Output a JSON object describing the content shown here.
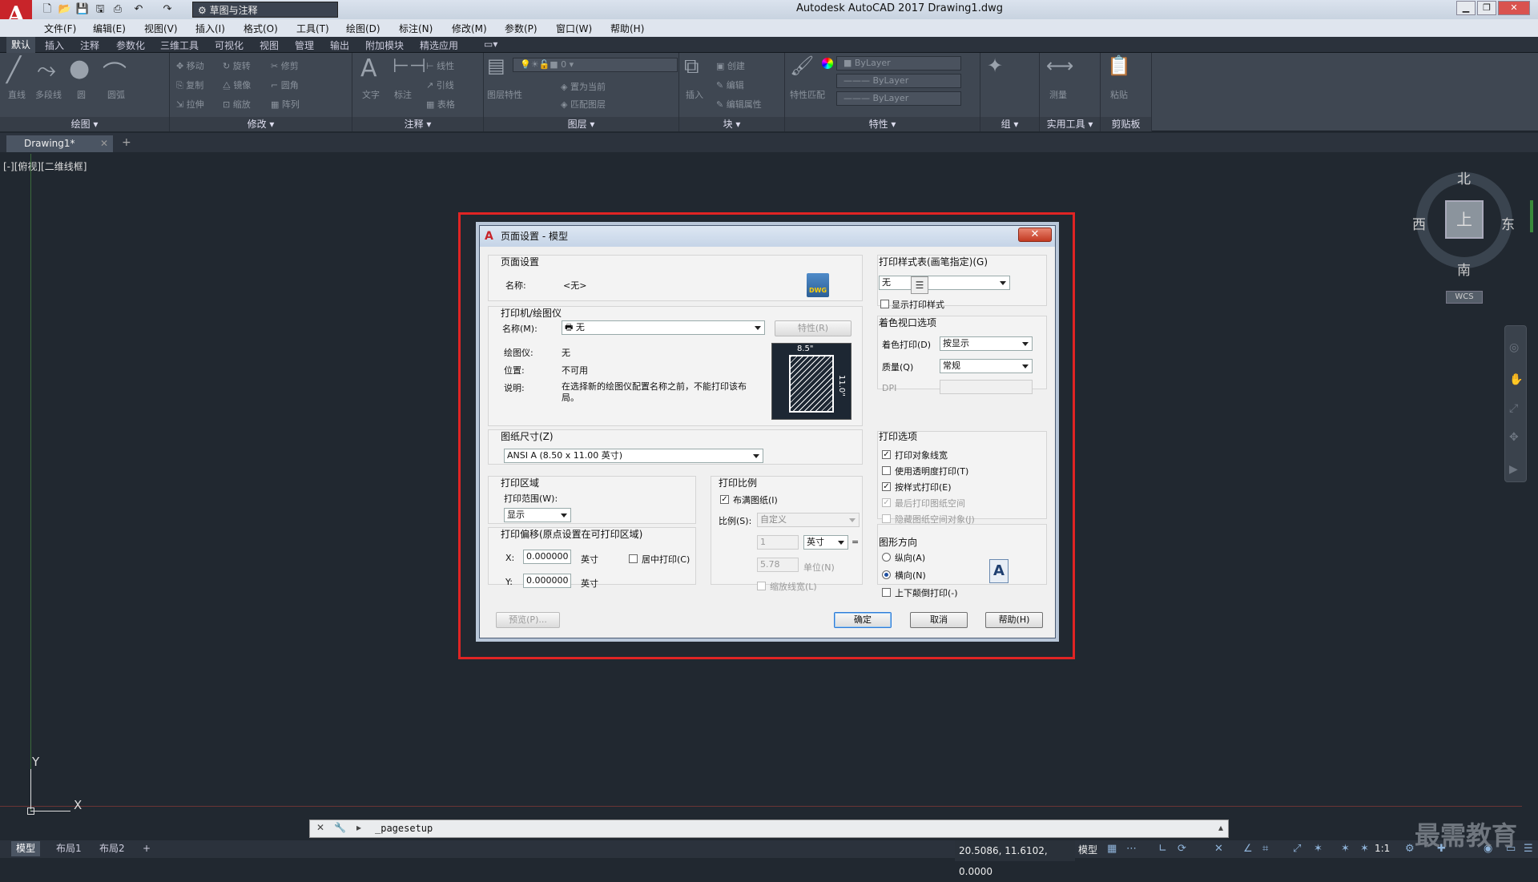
{
  "app": {
    "logo": "A",
    "window_title": "Autodesk AutoCAD 2017    Drawing1.dwg",
    "workspace": "草图与注释"
  },
  "menu": [
    "文件(F)",
    "编辑(E)",
    "视图(V)",
    "插入(I)",
    "格式(O)",
    "工具(T)",
    "绘图(D)",
    "标注(N)",
    "修改(M)",
    "参数(P)",
    "窗口(W)",
    "帮助(H)"
  ],
  "ribbon_tabs": [
    "默认",
    "插入",
    "注释",
    "参数化",
    "三维工具",
    "可视化",
    "视图",
    "管理",
    "输出",
    "附加模块",
    "精选应用"
  ],
  "ribbon": {
    "panels": [
      "绘图",
      "修改",
      "注释",
      "图层",
      "块",
      "特性",
      "组",
      "实用工具",
      "剪贴板"
    ],
    "draw_tools": [
      "直线",
      "多段线",
      "圆",
      "圆弧"
    ],
    "modify_tools": [
      "移动",
      "旋转",
      "修剪",
      "复制",
      "镜像",
      "圆角",
      "拉伸",
      "缩放",
      "阵列"
    ],
    "annotation_tools": [
      "文字",
      "标注",
      "线性",
      "引线",
      "表格"
    ],
    "layer_tools": [
      "图层特性",
      "置为当前",
      "匹配图层"
    ],
    "layer_current": "0",
    "block_tools": [
      "插入",
      "创建",
      "编辑",
      "编辑属性"
    ],
    "properties_tools": [
      "特性匹配"
    ],
    "bylayer": [
      "ByLayer",
      "ByLayer",
      "ByLayer"
    ],
    "utility_tools": [
      "测量"
    ],
    "clipboard_tools": [
      "粘贴"
    ]
  },
  "file_tabs": {
    "active": "Drawing1*"
  },
  "viewport": {
    "label": "[-][俯视][二维线框]"
  },
  "viewcube": {
    "north": "北",
    "south": "南",
    "east": "东",
    "west": "西",
    "top": "上",
    "wcs": "WCS"
  },
  "ucs": {
    "x": "X",
    "y": "Y"
  },
  "command_line": {
    "text": "_pagesetup"
  },
  "layout_tabs": [
    "模型",
    "布局1",
    "布局2"
  ],
  "status": {
    "coords": "20.5086, 11.6102, 0.0000",
    "model": "模型",
    "scale": "1:1"
  },
  "watermark": "最需教育",
  "dialog": {
    "title": "页面设置 - 模型",
    "page_setup": {
      "title": "页面设置",
      "name_label": "名称:",
      "name_value": "<无>",
      "dwg": "DWG"
    },
    "printer": {
      "title": "打印机/绘图仪",
      "name_label": "名称(M):",
      "name_value": "无",
      "properties_btn": "特性(R)",
      "plotter_label": "绘图仪:",
      "plotter_value": "无",
      "location_label": "位置:",
      "location_value": "不可用",
      "desc_label": "说明:",
      "desc_value": "在选择新的绘图仪配置名称之前，不能打印该布局。",
      "dim_w": "8.5\"",
      "dim_h": "11.0\""
    },
    "paper": {
      "title": "图纸尺寸(Z)",
      "value": "ANSI A (8.50 x 11.00 英寸)"
    },
    "area": {
      "title": "打印区域",
      "range_label": "打印范围(W):",
      "range_value": "显示"
    },
    "offset": {
      "title": "打印偏移(原点设置在可打印区域)",
      "x_label": "X:",
      "x_value": "0.000000",
      "x_unit": "英寸",
      "y_label": "Y:",
      "y_value": "0.000000",
      "y_unit": "英寸",
      "center": "居中打印(C)"
    },
    "scale": {
      "title": "打印比例",
      "fit": "布满图纸(I)",
      "ratio_label": "比例(S):",
      "ratio_value": "自定义",
      "v1": "1",
      "unit": "英寸",
      "eq": "=",
      "v2": "5.78",
      "unit2": "单位(N)",
      "lineweights": "缩放线宽(L)"
    },
    "style_table": {
      "title": "打印样式表(画笔指定)(G)",
      "value": "无",
      "show": "显示打印样式"
    },
    "shaded": {
      "title": "着色视口选项",
      "shade_label": "着色打印(D)",
      "shade_value": "按显示",
      "quality_label": "质量(Q)",
      "quality_value": "常规",
      "dpi_label": "DPI"
    },
    "options": {
      "title": "打印选项",
      "items": [
        "打印对象线宽",
        "使用透明度打印(T)",
        "按样式打印(E)",
        "最后打印图纸空间",
        "隐藏图纸空间对象(J)"
      ],
      "checked": [
        true,
        false,
        true,
        true,
        false
      ],
      "disabled": [
        false,
        false,
        false,
        true,
        true
      ]
    },
    "orientation": {
      "title": "图形方向",
      "portrait": "纵向(A)",
      "landscape": "横向(N)",
      "upside": "上下颠倒打印(-)",
      "icon": "A"
    },
    "buttons": {
      "preview": "预览(P)...",
      "ok": "确定",
      "cancel": "取消",
      "help": "帮助(H)",
      "close": "✕"
    }
  }
}
